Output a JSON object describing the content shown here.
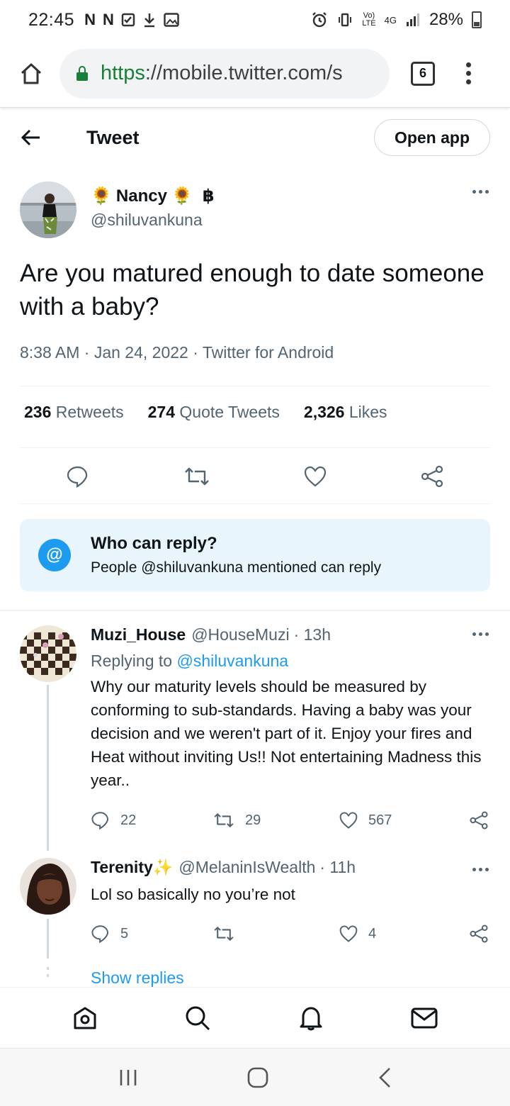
{
  "status_bar": {
    "time": "22:45",
    "left_icons": [
      "N",
      "N"
    ],
    "battery": "28%",
    "network": "4G"
  },
  "browser": {
    "url_scheme": "https",
    "url_rest": "://mobile.twitter.com/s",
    "tab_count": "6"
  },
  "header": {
    "title": "Tweet",
    "open_app": "Open app"
  },
  "tweet": {
    "display_name": "Nancy",
    "emoji": "🌻",
    "currency_badge": "฿",
    "handle": "@shiluvankuna",
    "text": "Are you matured enough to date someone with a baby?",
    "meta": "8:38 AM · Jan 24, 2022 · Twitter for Android",
    "stats": [
      {
        "count": "236",
        "label": "Retweets"
      },
      {
        "count": "274",
        "label": "Quote Tweets"
      },
      {
        "count": "2,326",
        "label": "Likes"
      }
    ]
  },
  "who_can_reply": {
    "icon": "@",
    "title": "Who can reply?",
    "subtitle": "People @shiluvankuna mentioned can reply"
  },
  "replies": [
    {
      "name": "Muzi_House",
      "handle": "@HouseMuzi",
      "time": "· 13h",
      "replying_prefix": "Replying to ",
      "replying_to": "@shiluvankuna",
      "text": "Why our maturity levels should be measured by conforming to sub-standards. Having a baby was your decision and we weren't part of it. Enjoy your fires and Heat without inviting Us!! Not entertaining Madness this year..",
      "replies": "22",
      "retweets": "29",
      "likes": "567"
    },
    {
      "name": "Terenity",
      "emoji": "✨",
      "handle": "@MelaninIsWealth",
      "time": "· 11h",
      "text": "Lol so basically no you’re not",
      "replies": "5",
      "retweets": "",
      "likes": "4"
    }
  ],
  "show_replies": "Show replies",
  "colors": {
    "accent": "#1d9bf0",
    "secure": "#188038",
    "muted": "#536471"
  }
}
